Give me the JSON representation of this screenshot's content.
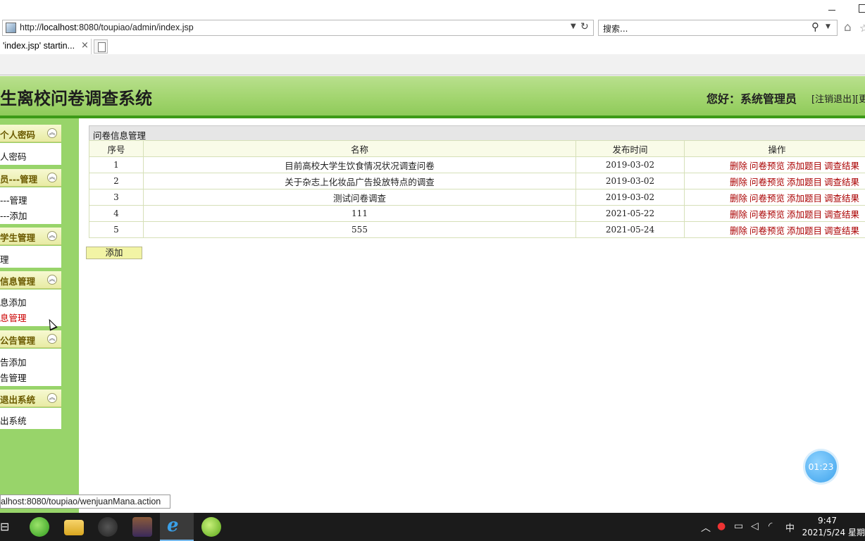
{
  "browser": {
    "url_prefix": "http://",
    "url_host": "localhost",
    "url_rest": ":8080/toupiao/admin/index.jsp",
    "search_placeholder": "搜索...",
    "tab_title": "'index.jsp' startin...",
    "tab_close": "×"
  },
  "header": {
    "title": "生离校问卷调查系统",
    "greeting": "您好：系统管理员",
    "logout": "[注销退出]",
    "logout2": "[更"
  },
  "sidebar": {
    "sections": [
      {
        "title": "个人密码",
        "items": [
          "人密码"
        ]
      },
      {
        "title": "员---管理",
        "items": [
          "---管理",
          "---添加"
        ]
      },
      {
        "title": "学生管理",
        "items": [
          "理"
        ]
      },
      {
        "title": "信息管理",
        "items": [
          "息添加",
          "息管理"
        ]
      },
      {
        "title": "公告管理",
        "items": [
          "告添加",
          "告管理"
        ]
      },
      {
        "title": "退出系统",
        "items": [
          "出系统"
        ]
      }
    ],
    "chevron": "︽"
  },
  "main": {
    "panel_title": "问卷信息管理",
    "columns": [
      "序号",
      "名称",
      "发布时间",
      "操作"
    ],
    "rows": [
      {
        "id": "1",
        "name": "目前高校大学生饮食情况状况调查问卷",
        "date": "2019-03-02"
      },
      {
        "id": "2",
        "name": "关于杂志上化妆品广告投放特点的调查",
        "date": "2019-03-02"
      },
      {
        "id": "3",
        "name": "测试问卷调查",
        "date": "2019-03-02"
      },
      {
        "id": "4",
        "name": "111",
        "date": "2021-05-22"
      },
      {
        "id": "5",
        "name": "555",
        "date": "2021-05-24"
      }
    ],
    "ops": [
      "删除",
      "问卷预览",
      "添加题目",
      "调查结果"
    ],
    "add_button": "添加"
  },
  "status_bar": "alhost:8080/toupiao/wenjuanMana.action",
  "timer": "01:23",
  "taskbar": {
    "time": "9:47",
    "date": "2021/5/24 星期",
    "ime": "中"
  },
  "colors": {
    "header_green": "#a2d56f",
    "sidebar_green": "#98d46a",
    "op_red": "#a00"
  }
}
